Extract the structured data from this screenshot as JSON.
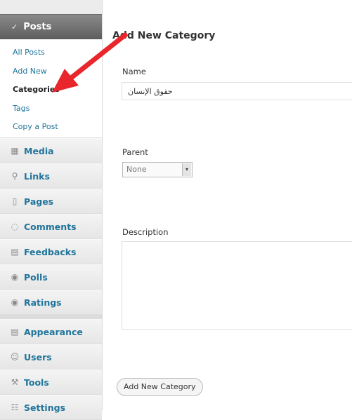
{
  "sidebar": {
    "posts_header": "Posts",
    "submenu": [
      {
        "label": "All Posts"
      },
      {
        "label": "Add New"
      },
      {
        "label": "Categories"
      },
      {
        "label": "Tags"
      },
      {
        "label": "Copy a Post"
      }
    ],
    "menu": [
      {
        "label": "Media",
        "icon": "media-icon"
      },
      {
        "label": "Links",
        "icon": "links-icon"
      },
      {
        "label": "Pages",
        "icon": "pages-icon"
      },
      {
        "label": "Comments",
        "icon": "comments-icon"
      },
      {
        "label": "Feedbacks",
        "icon": "feedbacks-icon"
      },
      {
        "label": "Polls",
        "icon": "polls-icon"
      },
      {
        "label": "Ratings",
        "icon": "ratings-icon"
      },
      {
        "label": "Appearance",
        "icon": "appearance-icon"
      },
      {
        "label": "Users",
        "icon": "users-icon"
      },
      {
        "label": "Tools",
        "icon": "tools-icon"
      },
      {
        "label": "Settings",
        "icon": "settings-icon"
      }
    ]
  },
  "form": {
    "heading": "Add New Category",
    "name_label": "Name",
    "name_value": "حقوق الإنسان",
    "parent_label": "Parent",
    "parent_value": "None",
    "description_label": "Description",
    "submit_label": "Add New Category"
  },
  "colors": {
    "link": "#21759b",
    "arrow": "#e8262b",
    "header_bg": "#6f6f6f"
  }
}
